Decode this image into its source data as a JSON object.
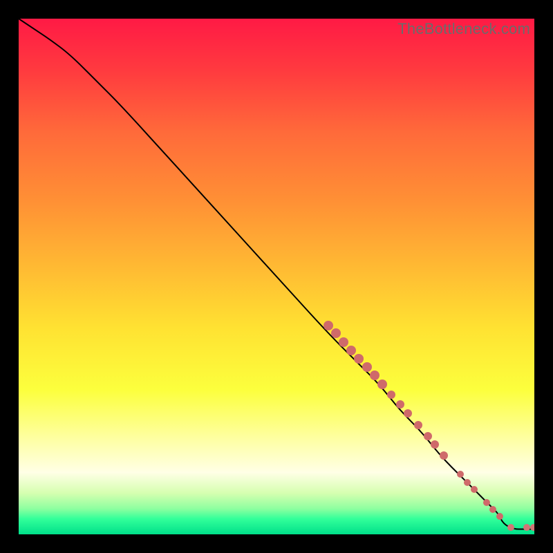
{
  "watermark": "TheBottleneck.com",
  "colors": {
    "line": "#000000",
    "dot_fill": "#cf6a6a",
    "dot_fill_end": "#d07676",
    "gradient_stops": [
      {
        "pct": 0,
        "color": "#ff1a45"
      },
      {
        "pct": 10,
        "color": "#ff3a3f"
      },
      {
        "pct": 22,
        "color": "#ff6a3a"
      },
      {
        "pct": 35,
        "color": "#ff8f35"
      },
      {
        "pct": 48,
        "color": "#ffb933"
      },
      {
        "pct": 60,
        "color": "#ffe232"
      },
      {
        "pct": 72,
        "color": "#fcff3d"
      },
      {
        "pct": 82,
        "color": "#feffa8"
      },
      {
        "pct": 88,
        "color": "#ffffe6"
      },
      {
        "pct": 92,
        "color": "#d6ffb0"
      },
      {
        "pct": 95,
        "color": "#8effa0"
      },
      {
        "pct": 97,
        "color": "#32ff9a"
      },
      {
        "pct": 100,
        "color": "#00e08a"
      }
    ]
  },
  "chart_data": {
    "type": "line",
    "title": "",
    "xlabel": "",
    "ylabel": "",
    "xlim": [
      0,
      100
    ],
    "ylim": [
      0,
      100
    ],
    "grid": false,
    "legend": false,
    "series": [
      {
        "name": "descending-curve",
        "x": [
          0,
          3,
          6,
          10,
          15,
          20,
          30,
          40,
          50,
          60,
          66,
          70,
          74,
          78,
          82,
          86,
          89,
          92,
          93,
          94,
          96,
          98,
          100
        ],
        "y": [
          100,
          98,
          96,
          93,
          88,
          83,
          72,
          61,
          50,
          39,
          33,
          29,
          24,
          20,
          15,
          11,
          8,
          5,
          4,
          2,
          1,
          1,
          1
        ]
      }
    ],
    "scatter": [
      {
        "x": 60.0,
        "y": 40.5,
        "r": 7
      },
      {
        "x": 61.5,
        "y": 39.0,
        "r": 7
      },
      {
        "x": 63.0,
        "y": 37.3,
        "r": 7
      },
      {
        "x": 64.5,
        "y": 35.7,
        "r": 7
      },
      {
        "x": 66.0,
        "y": 34.0,
        "r": 7
      },
      {
        "x": 67.5,
        "y": 32.4,
        "r": 7
      },
      {
        "x": 69.0,
        "y": 30.8,
        "r": 7
      },
      {
        "x": 70.5,
        "y": 29.1,
        "r": 7
      },
      {
        "x": 72.3,
        "y": 27.1,
        "r": 6
      },
      {
        "x": 74.0,
        "y": 25.2,
        "r": 6
      },
      {
        "x": 75.5,
        "y": 23.5,
        "r": 6
      },
      {
        "x": 77.5,
        "y": 21.2,
        "r": 6
      },
      {
        "x": 79.3,
        "y": 19.1,
        "r": 6
      },
      {
        "x": 80.7,
        "y": 17.4,
        "r": 6
      },
      {
        "x": 82.5,
        "y": 15.3,
        "r": 6
      },
      {
        "x": 85.7,
        "y": 11.6,
        "r": 5
      },
      {
        "x": 87.0,
        "y": 10.1,
        "r": 5
      },
      {
        "x": 88.3,
        "y": 8.7,
        "r": 5
      },
      {
        "x": 90.7,
        "y": 6.1,
        "r": 5
      },
      {
        "x": 92.0,
        "y": 4.8,
        "r": 5
      },
      {
        "x": 93.3,
        "y": 3.5,
        "r": 5
      },
      {
        "x": 95.4,
        "y": 1.4,
        "r": 5
      },
      {
        "x": 98.5,
        "y": 1.3,
        "r": 5
      },
      {
        "x": 99.8,
        "y": 1.3,
        "r": 5
      }
    ]
  }
}
